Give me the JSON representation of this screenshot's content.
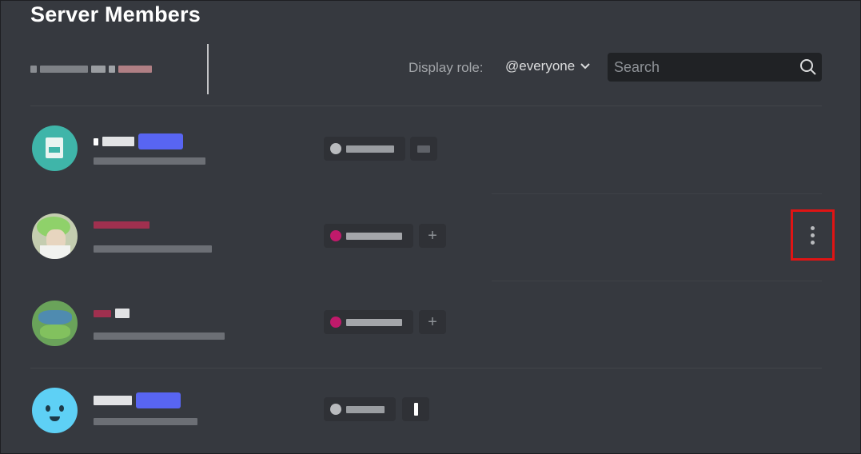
{
  "page": {
    "title": "Server Members"
  },
  "toolbar": {
    "display_role_label": "Display role:",
    "role_value": "@everyone",
    "search_placeholder": "Search"
  },
  "colors": {
    "background": "#36393f",
    "search_bg": "#202225",
    "blurple": "#5865f2",
    "highlight_red": "#e01414",
    "role_magenta": "#c01a6b",
    "role_gray": "#b9bbbe"
  },
  "icons": {
    "search": "search-icon",
    "chevron": "chevron-down-icon",
    "more": "more-vertical-icon",
    "add": "plus-icon"
  },
  "members": [
    {
      "avatar_color": "#3fb5a9",
      "role_dot": "#b9bbbe",
      "has_badge": true
    },
    {
      "avatar_color": "#b7c9a3",
      "role_dot": "#c01a6b",
      "has_badge": false
    },
    {
      "avatar_color": "#6aa35a",
      "role_dot": "#c01a6b",
      "has_badge": false
    },
    {
      "avatar_color": "#5ed0f5",
      "role_dot": "#b9bbbe",
      "has_badge": true
    }
  ]
}
